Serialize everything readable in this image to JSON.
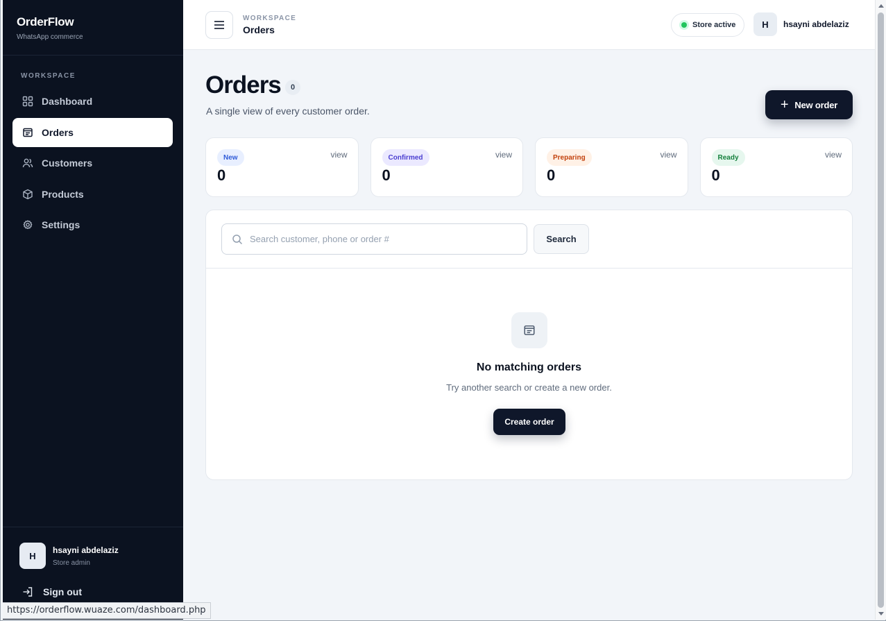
{
  "sidebar": {
    "brand": "OrderFlow",
    "brand_sub": "WhatsApp commerce",
    "section_label": "WORKSPACE",
    "items": [
      {
        "label": "Dashboard",
        "icon": "grid-icon"
      },
      {
        "label": "Orders",
        "icon": "orders-icon",
        "active": true
      },
      {
        "label": "Customers",
        "icon": "users-icon"
      },
      {
        "label": "Products",
        "icon": "box-icon"
      },
      {
        "label": "Settings",
        "icon": "gear-icon"
      }
    ],
    "user": {
      "initial": "H",
      "name": "hsayni abdelaziz",
      "role": "Store admin"
    },
    "signout": "Sign out"
  },
  "header": {
    "kicker": "WORKSPACE",
    "title": "Orders",
    "store_status": "Store active",
    "user_initial": "H",
    "user_name": "hsayni abdelaziz"
  },
  "main": {
    "title": "Orders",
    "count": "0",
    "subtitle": "A single view of every customer order.",
    "new_order_label": "New order",
    "cards": [
      {
        "label": "New",
        "value": "0",
        "link": "view",
        "bg": "#e8efff",
        "fg": "#2f5bd8"
      },
      {
        "label": "Confirmed",
        "value": "0",
        "link": "view",
        "bg": "#ebe9ff",
        "fg": "#4b3fd1"
      },
      {
        "label": "Preparing",
        "value": "0",
        "link": "view",
        "bg": "#fff1e6",
        "fg": "#c2410c"
      },
      {
        "label": "Ready",
        "value": "0",
        "link": "view",
        "bg": "#e6f7ee",
        "fg": "#15803d"
      }
    ],
    "search": {
      "placeholder": "Search customer, phone or order #",
      "value": "",
      "button": "Search"
    },
    "empty": {
      "title": "No matching orders",
      "subtitle": "Try another search or create a new order.",
      "button": "Create order"
    }
  },
  "status_url": "https://orderflow.wuaze.com/dashboard.php",
  "colors": {
    "sidebar_bg": "#0b1220",
    "primary": "#0f172a",
    "page_bg": "#f2f5f9",
    "status_dot": "#22c55e"
  }
}
